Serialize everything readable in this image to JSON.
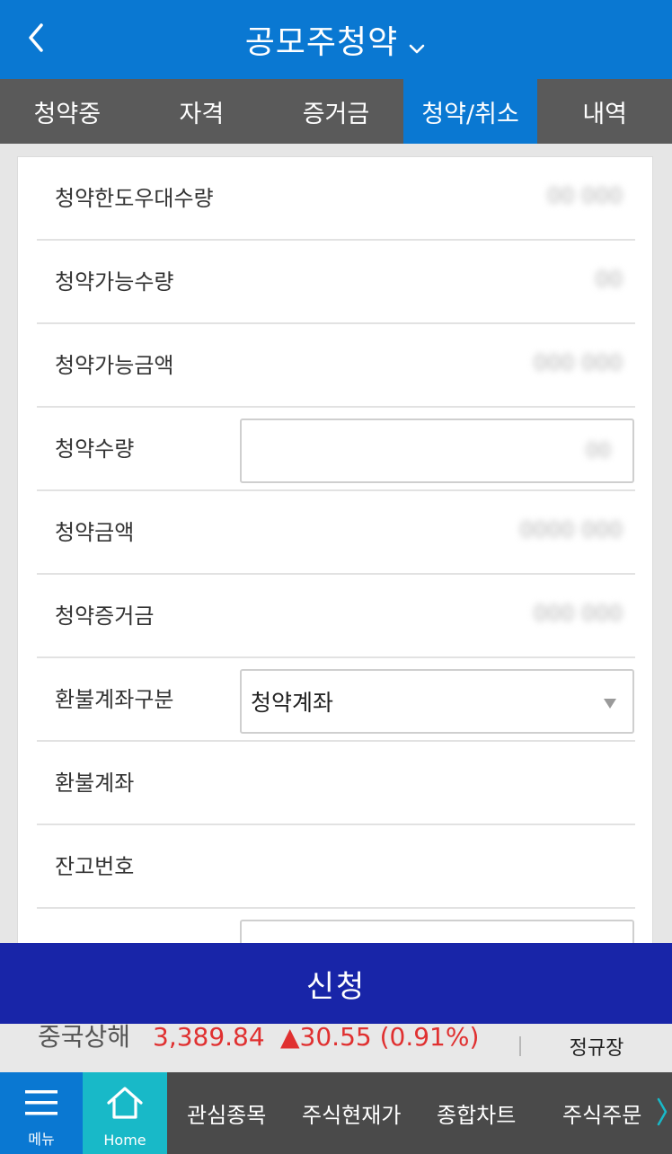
{
  "header": {
    "title": "공모주청약"
  },
  "tabs": [
    {
      "label": "청약중"
    },
    {
      "label": "자격"
    },
    {
      "label": "증거금"
    },
    {
      "label": "청약/취소",
      "active": true
    },
    {
      "label": "내역"
    }
  ],
  "form": {
    "rows": [
      {
        "label": "청약한도우대수량",
        "value": "00 000"
      },
      {
        "label": "청약가능수량",
        "value": "00"
      },
      {
        "label": "청약가능금액",
        "value": "000 000"
      },
      {
        "label": "청약수량",
        "value": "00"
      },
      {
        "label": "청약금액",
        "value": "0000 000"
      },
      {
        "label": "청약증거금",
        "value": "000 000"
      },
      {
        "label": "환불계좌구분",
        "value": "청약계좌"
      },
      {
        "label": "환불계좌",
        "value": ""
      },
      {
        "label": "잔고번호",
        "value": ""
      }
    ]
  },
  "submit": {
    "label": "신청"
  },
  "ticker": {
    "name": "중국상해",
    "price": "3,389.84",
    "change": "▲30.55 (0.91%)",
    "market": "정규장"
  },
  "bottom_nav": {
    "menu_label": "메뉴",
    "home_label": "Home",
    "items": [
      {
        "label": "관심종목"
      },
      {
        "label": "주식현재가"
      },
      {
        "label": "종합차트"
      },
      {
        "label": "주식주문"
      }
    ]
  },
  "colors": {
    "header_blue": "#0a78d2",
    "submit_navy": "#1825a8",
    "home_teal": "#18b9c8",
    "up_red": "#e03030"
  }
}
